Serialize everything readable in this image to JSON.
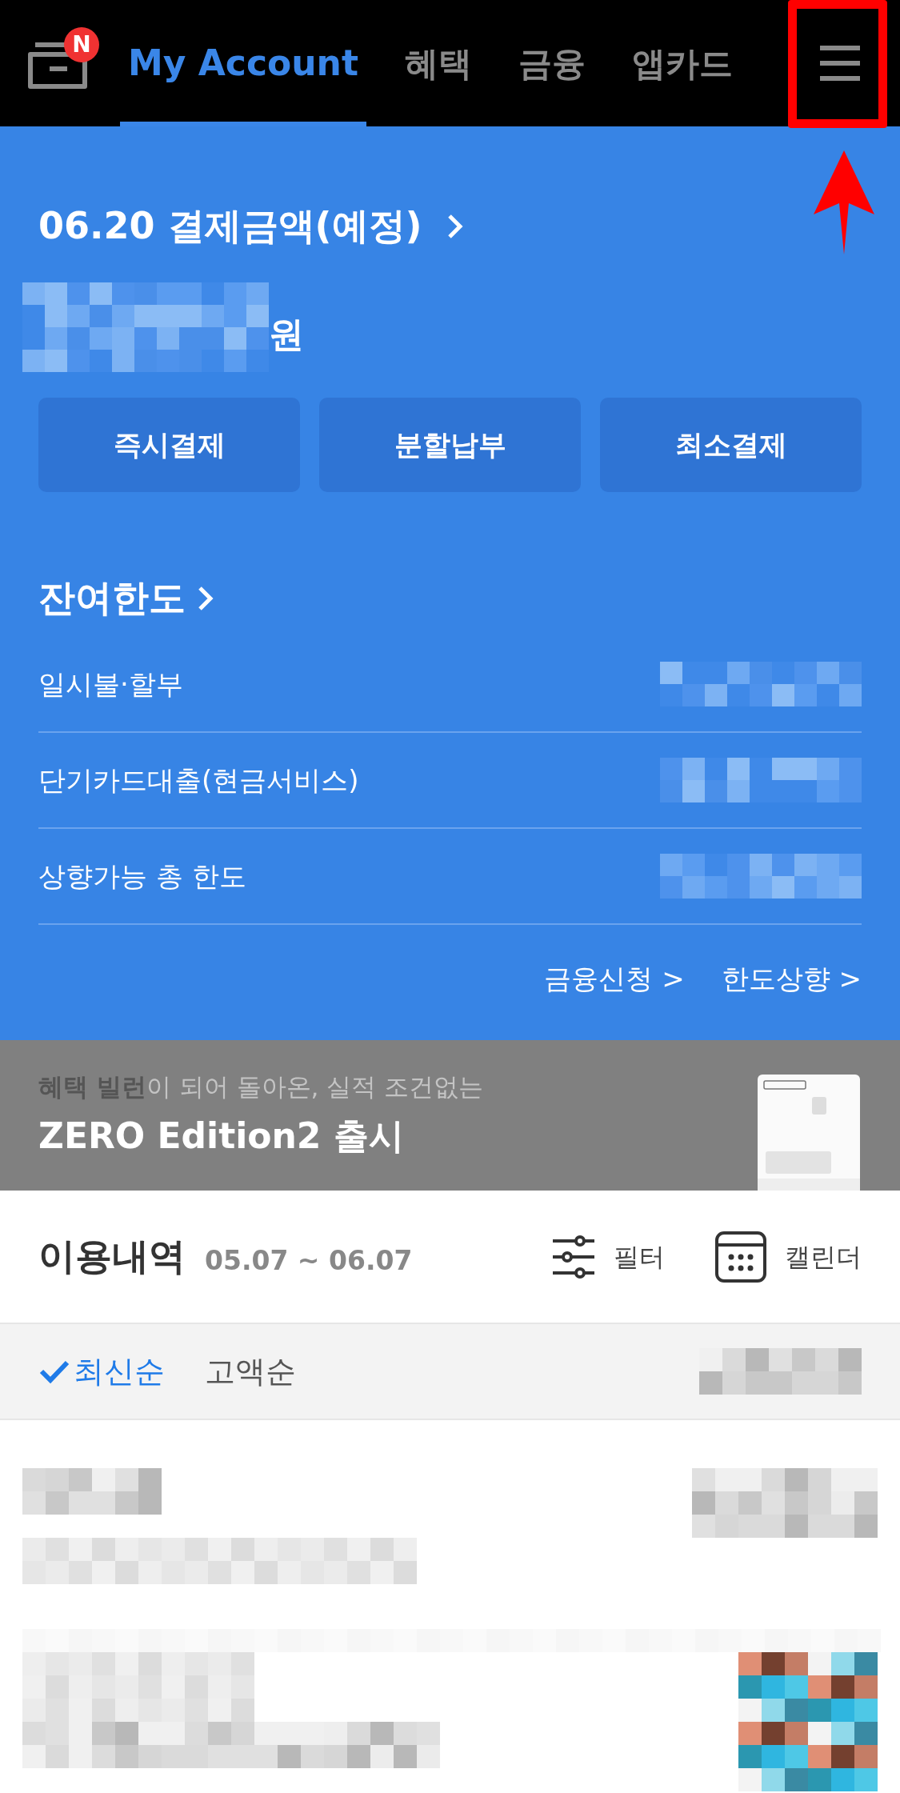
{
  "top_bar": {
    "notification_badge": "N",
    "tabs": [
      {
        "label": "My Account",
        "selected": true
      },
      {
        "label": "혜택",
        "selected": false
      },
      {
        "label": "금융",
        "selected": false
      },
      {
        "label": "앱카드",
        "selected": false
      }
    ],
    "menu": {
      "highlighted": true
    }
  },
  "payment": {
    "title": "06.20 결제금액(예정)",
    "currency": "원",
    "buttons": [
      "즉시결제",
      "분할납부",
      "최소결제"
    ]
  },
  "limit": {
    "title": "잔여한도",
    "rows": [
      {
        "label": "일시불·할부"
      },
      {
        "label": "단기카드대출(현금서비스)"
      },
      {
        "label": "상향가능 총 한도"
      }
    ],
    "links": [
      "금융신청 >",
      "한도상향 >"
    ]
  },
  "banner": {
    "text": "**혜택 빌런**이 되어 돌아온, 실적 조건없는",
    "title": "ZERO Edition2 출시",
    "kind": "picture"
  },
  "history": {
    "title": "이용내역",
    "period": "05.07 ~ 06.07",
    "actions": [
      {
        "kind": "filter",
        "label": "필터"
      },
      {
        "kind": "calendar",
        "label": "캘린더"
      }
    ]
  },
  "sort": [
    {
      "label": "최신순",
      "selected": true
    },
    {
      "label": "고액순",
      "selected": false
    }
  ]
}
